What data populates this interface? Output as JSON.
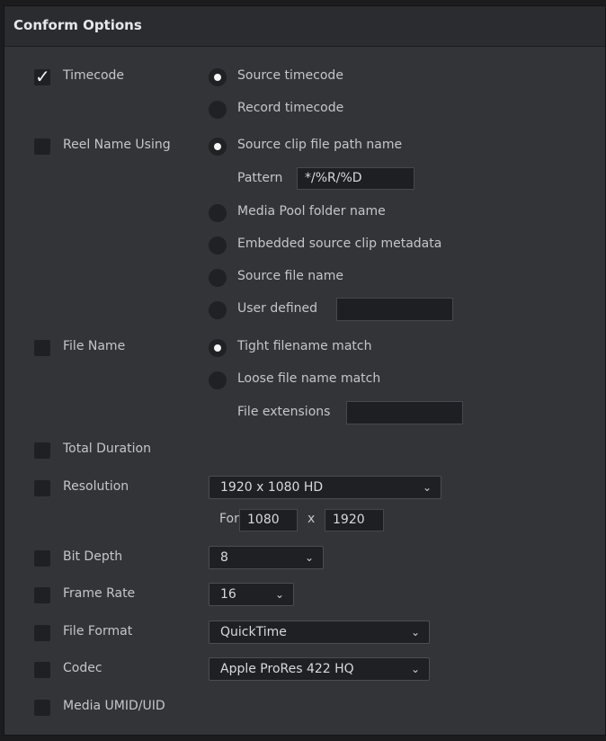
{
  "panel": {
    "title": "Conform Options"
  },
  "rows": {
    "timecode": {
      "label": "Timecode",
      "checked": true,
      "options": [
        "Source timecode",
        "Record timecode"
      ],
      "selected": 0
    },
    "reel_name": {
      "label": "Reel Name Using",
      "checked": false,
      "options": [
        "Source clip file path name",
        "Media Pool folder name",
        "Embedded source clip metadata",
        "Source file name",
        "User defined"
      ],
      "selected": 0,
      "pattern_label": "Pattern",
      "pattern_value": "*/%R/%D",
      "user_defined_value": ""
    },
    "file_name": {
      "label": "File Name",
      "checked": false,
      "options": [
        "Tight filename match",
        "Loose file name match"
      ],
      "selected": 0,
      "extensions_label": "File extensions",
      "extensions_value": ""
    },
    "total_duration": {
      "label": "Total Duration",
      "checked": false
    },
    "resolution": {
      "label": "Resolution",
      "checked": false,
      "value": "1920 x 1080 HD",
      "for_label": "For",
      "height": "1080",
      "x_label": "x",
      "width": "1920"
    },
    "bit_depth": {
      "label": "Bit Depth",
      "checked": false,
      "value": "8"
    },
    "frame_rate": {
      "label": "Frame Rate",
      "checked": false,
      "value": "16"
    },
    "file_format": {
      "label": "File Format",
      "checked": false,
      "value": "QuickTime"
    },
    "codec": {
      "label": "Codec",
      "checked": false,
      "value": "Apple ProRes 422 HQ"
    },
    "media_umid": {
      "label": "Media UMID/UID",
      "checked": false
    }
  },
  "icons": {
    "check": "checkmark-icon",
    "dropdown": "chevron-down-icon"
  },
  "colors": {
    "panel_bg": "#333438",
    "header_bg": "#2b2c30",
    "control_bg": "#1f2023",
    "text": "#c5c6ca"
  }
}
